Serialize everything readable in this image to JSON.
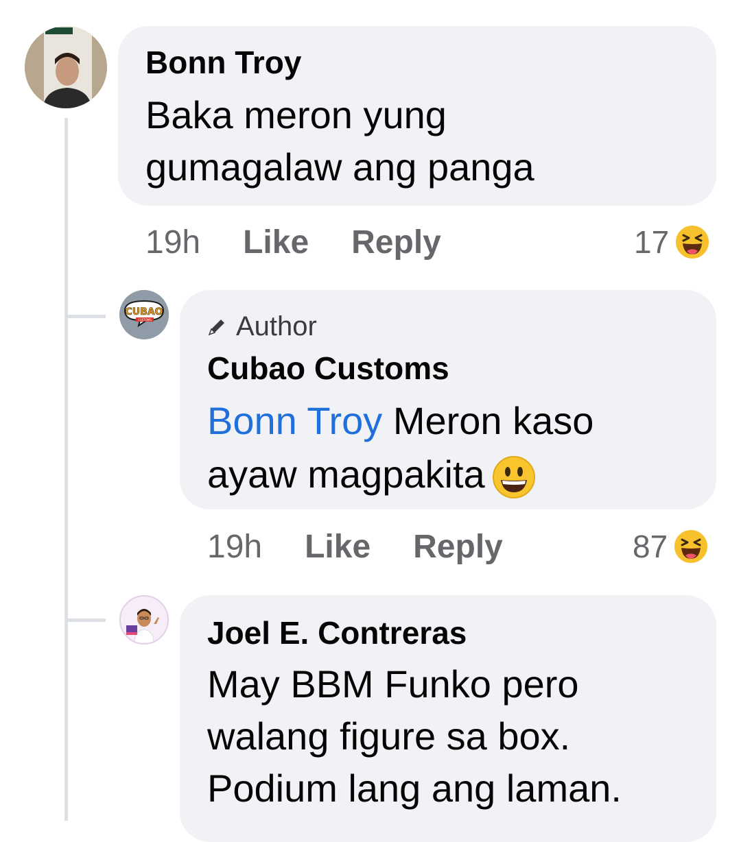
{
  "comments": [
    {
      "author": "Bonn Troy",
      "text_lines": [
        "Baka meron yung",
        "gumagalaw ang panga"
      ],
      "time": "19h",
      "like_label": "Like",
      "reply_label": "Reply",
      "reaction_count": "17",
      "reaction_icon": "haha-icon"
    },
    {
      "badge": "Author",
      "author": "Cubao Customs",
      "mention": "Bonn Troy",
      "text_line1_rest": " Meron kaso",
      "text_line2": "ayaw magpakita",
      "emoji": "grinning-face-icon",
      "time": "19h",
      "like_label": "Like",
      "reply_label": "Reply",
      "reaction_count": "87",
      "reaction_icon": "haha-icon"
    },
    {
      "author": "Joel E. Contreras",
      "text_lines": [
        "May BBM Funko pero",
        "walang figure sa box.",
        "Podium lang ang laman."
      ]
    }
  ],
  "avatars": {
    "cubao_logo_text": "CUBAO",
    "cubao_logo_sub": "CUSTOMS"
  },
  "colors": {
    "bubble": "#f0f2f5",
    "mention": "#216fdb",
    "meta_text": "#65676b",
    "thread_line": "#dcdfe3"
  }
}
